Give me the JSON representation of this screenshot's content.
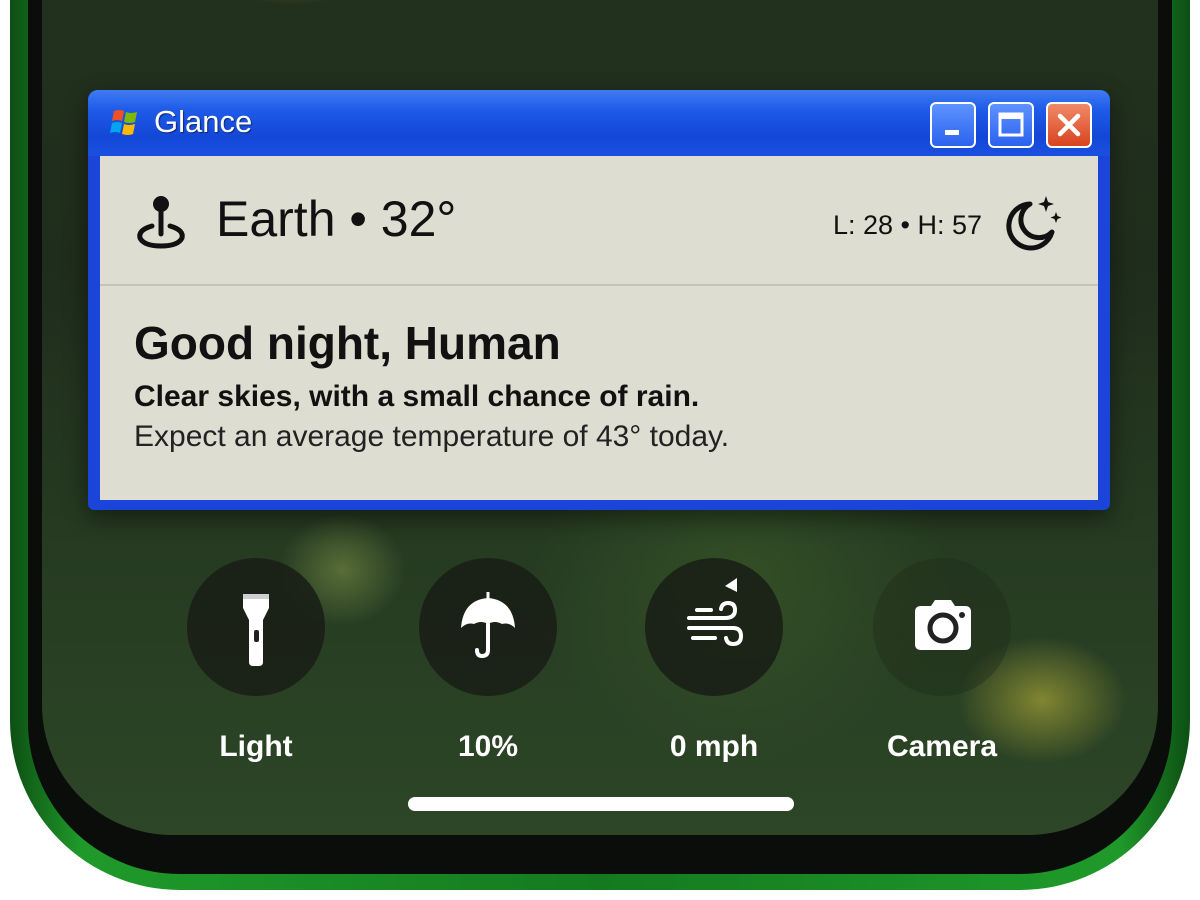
{
  "window": {
    "title": "Glance",
    "title_bar_color": "#1b44d8",
    "buttons": [
      "minimize-icon",
      "maximize-icon",
      "close-icon"
    ]
  },
  "weather": {
    "location_line": "Earth • 32°",
    "low_high": "L: 28 • H: 57",
    "condition_icon": "moon-stars-icon",
    "greeting": "Good night, Human",
    "summary": "Clear skies, with a small chance of rain.",
    "detail": "Expect an average temperature of 43° today."
  },
  "quick_actions": [
    {
      "icon": "flashlight-icon",
      "label": "Light"
    },
    {
      "icon": "umbrella-icon",
      "label": "10%"
    },
    {
      "icon": "wind-icon",
      "label": "0 mph"
    },
    {
      "icon": "camera-icon",
      "label": "Camera"
    }
  ],
  "colors": {
    "phone_frame": "#157a1f",
    "window_client": "#deddd1",
    "close_button": "#d9431e"
  }
}
